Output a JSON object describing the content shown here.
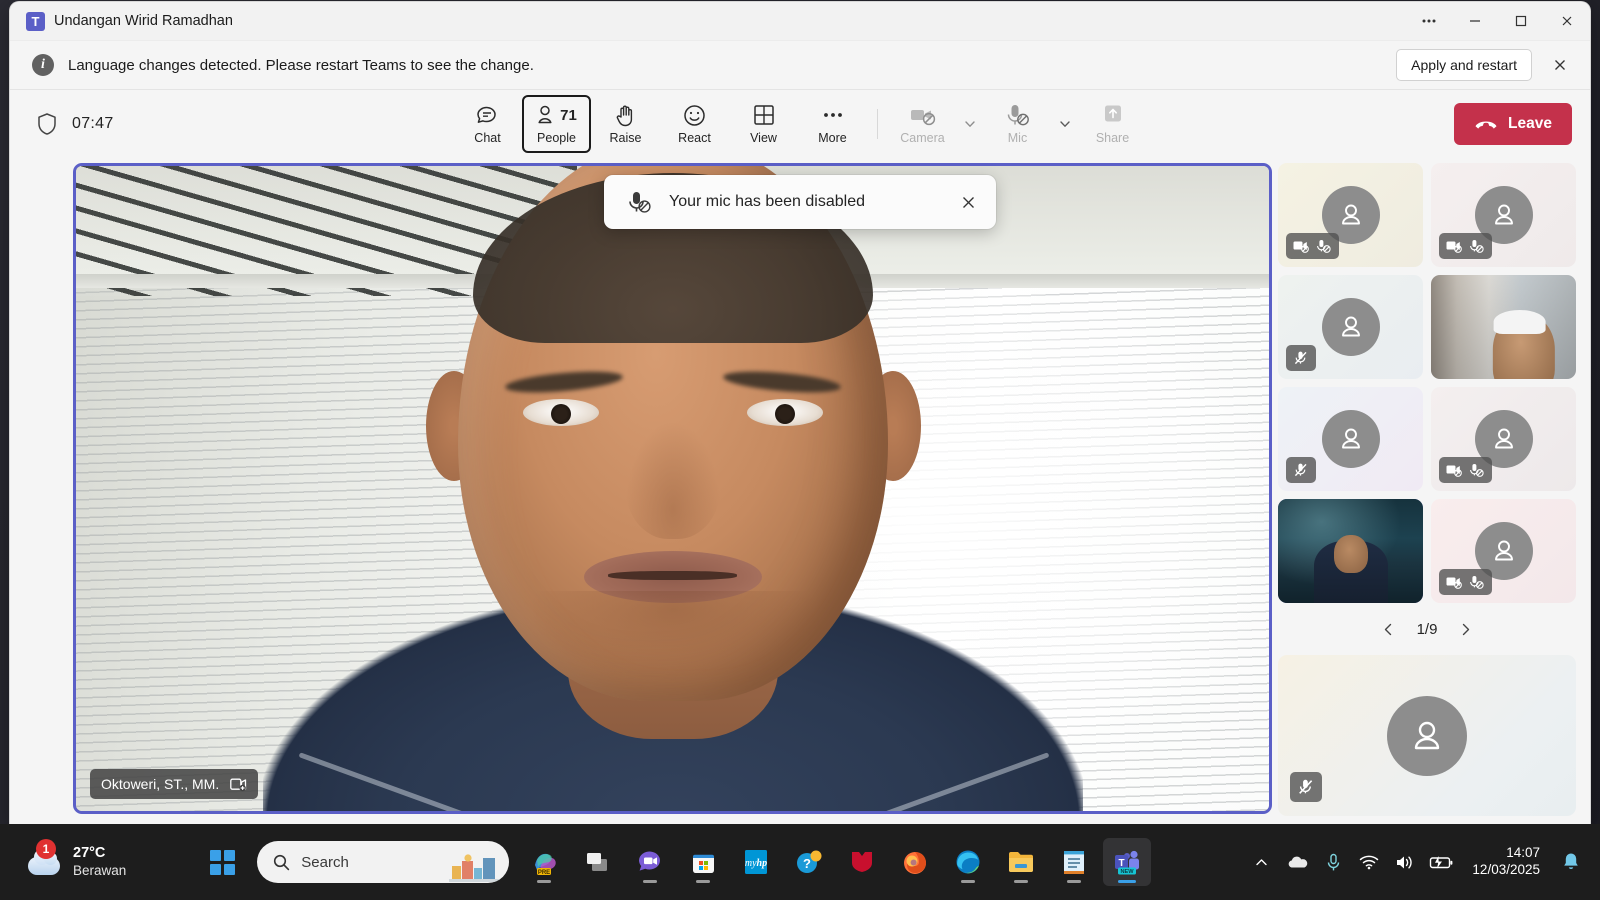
{
  "window": {
    "title": "Undangan Wirid Ramadhan",
    "app_icon": "teams-logo",
    "controls": {
      "more": "…",
      "minimize": "minimize-icon",
      "maximize": "maximize-icon",
      "close": "close-icon"
    }
  },
  "banner": {
    "icon": "info-icon",
    "message": "Language changes detected. Please restart Teams to see the change.",
    "action_label": "Apply and restart",
    "close": "close-icon"
  },
  "toolbar": {
    "shield_icon": "shield-icon",
    "timer": "07:47",
    "buttons": [
      {
        "label": "Chat",
        "icon": "chat-icon",
        "state": "enabled"
      },
      {
        "label": "People",
        "icon": "people-icon",
        "state": "focused",
        "count": "71"
      },
      {
        "label": "Raise",
        "icon": "hand-icon",
        "state": "enabled"
      },
      {
        "label": "React",
        "icon": "smiley-icon",
        "state": "enabled"
      },
      {
        "label": "View",
        "icon": "grid-icon",
        "state": "enabled"
      },
      {
        "label": "More",
        "icon": "ellipsis-icon",
        "state": "enabled"
      }
    ],
    "camera": {
      "label": "Camera",
      "icon": "camera-off-icon",
      "state": "disabled",
      "chevron": "chevron-down-icon"
    },
    "mic": {
      "label": "Mic",
      "icon": "mic-off-icon",
      "state": "disabled",
      "chevron": "chevron-down-icon"
    },
    "share": {
      "label": "Share",
      "icon": "share-up-icon",
      "state": "disabled"
    },
    "leave": {
      "label": "Leave",
      "icon": "hangup-icon",
      "color": "#c4314b"
    }
  },
  "toast": {
    "icon": "mic-off-icon",
    "message": "Your mic has been disabled",
    "close": "close-icon"
  },
  "main_video": {
    "participant_name": "Oktoweri, ST., MM.",
    "badge_icon": "pin-video-icon",
    "border_color": "#5b5fc7",
    "is_active_speaker": true
  },
  "roster": {
    "tiles": [
      {
        "id": 1,
        "kind": "avatar",
        "bg": "#f3f1e6",
        "badges": [
          "camera-off-icon",
          "mic-off-icon"
        ]
      },
      {
        "id": 2,
        "kind": "avatar",
        "bg": "#f2eeee",
        "badges": [
          "camera-off-icon",
          "mic-off-icon"
        ]
      },
      {
        "id": 3,
        "kind": "avatar",
        "bg": "#eef1ee",
        "badges": [
          "mic-muted-icon"
        ]
      },
      {
        "id": 4,
        "kind": "video-office",
        "bg": "#cfcac2",
        "badges": []
      },
      {
        "id": 5,
        "kind": "avatar",
        "bg": "#f0edf4",
        "badges": [
          "mic-muted-icon"
        ]
      },
      {
        "id": 6,
        "kind": "avatar",
        "bg": "#f1eeee",
        "badges": [
          "camera-off-icon",
          "mic-off-icon"
        ]
      },
      {
        "id": 7,
        "kind": "video-space",
        "bg": "#16323d",
        "badges": [],
        "active": true
      },
      {
        "id": 8,
        "kind": "avatar",
        "bg": "#f7ecec",
        "badges": [
          "camera-off-icon",
          "mic-off-icon"
        ]
      }
    ],
    "pager": {
      "prev_icon": "chevron-left-icon",
      "label": "1/9",
      "next_icon": "chevron-right-icon"
    },
    "wide_tile": {
      "kind": "avatar",
      "bg": "#f2efe9",
      "badges": [
        "mic-muted-icon"
      ]
    }
  },
  "taskbar": {
    "weather": {
      "temperature": "27°C",
      "condition": "Berawan",
      "badge": "1",
      "icon": "cloud-icon"
    },
    "start": {
      "icon": "windows-logo-icon"
    },
    "search": {
      "placeholder": "Search",
      "icon": "search-icon"
    },
    "pinned": [
      {
        "name": "copilot-icon",
        "label": "Copilot"
      },
      {
        "name": "task-view-icon",
        "label": "Task View"
      },
      {
        "name": "teams-chat-icon",
        "label": "Chat"
      },
      {
        "name": "microsoft-store-icon",
        "label": "Microsoft Store"
      },
      {
        "name": "myhp-icon",
        "label": "myHP"
      },
      {
        "name": "get-help-icon",
        "label": "Get Help"
      },
      {
        "name": "mcafee-icon",
        "label": "McAfee"
      },
      {
        "name": "firefox-icon",
        "label": "Firefox"
      },
      {
        "name": "edge-icon",
        "label": "Microsoft Edge"
      },
      {
        "name": "file-explorer-icon",
        "label": "File Explorer"
      },
      {
        "name": "notepad-icon",
        "label": "Notepad"
      },
      {
        "name": "teams-new-icon",
        "label": "Microsoft Teams",
        "badge": "NEW",
        "active": true
      }
    ],
    "tray": {
      "chevron_icon": "chevron-up-icon",
      "onedrive_icon": "cloud-icon",
      "mic_icon": "mic-icon",
      "wifi_icon": "wifi-icon",
      "volume_icon": "speaker-icon",
      "battery_icon": "battery-charging-icon",
      "notification_icon": "bell-icon"
    },
    "clock": {
      "time": "14:07",
      "date": "12/03/2025"
    }
  }
}
